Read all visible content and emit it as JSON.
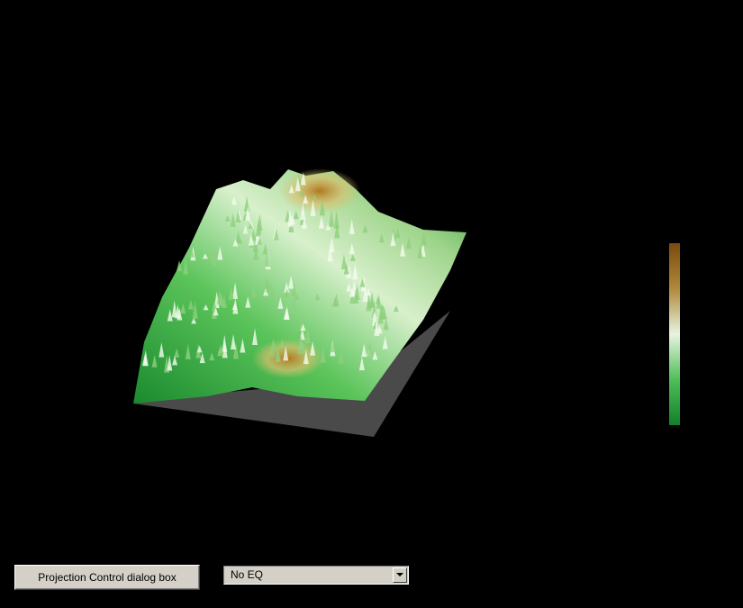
{
  "view": {
    "background": "#000000",
    "terrain_colors": {
      "low": "#1a8a2e",
      "mid": "#e8f4e0",
      "high": "#7a4a10",
      "shadow": "#4a4a4a"
    }
  },
  "colorbar": {
    "gradient": [
      "#7a4a10",
      "#b08a3a",
      "#e8f4e0",
      "#4fbf5a",
      "#13802a"
    ]
  },
  "controls": {
    "projection_button_label": "Projection Control dialog box",
    "eq_select": {
      "selected": "No EQ",
      "icon": "chevron-down-icon"
    }
  }
}
